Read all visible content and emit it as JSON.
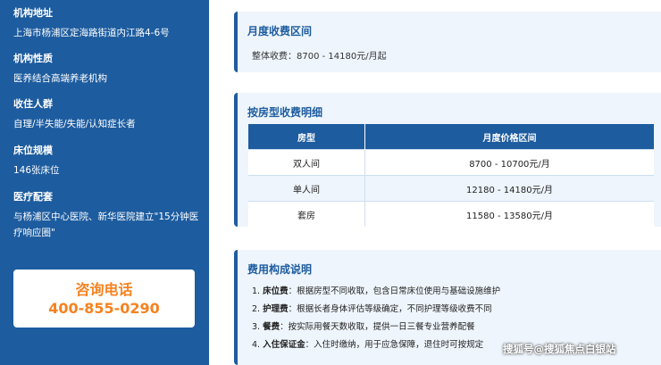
{
  "sidebar": {
    "items": [
      {
        "label": "机构地址",
        "value": "上海市杨浦区定海路街道内江路4-6号"
      },
      {
        "label": "机构性质",
        "value": "医养结合高端养老机构"
      },
      {
        "label": "收住人群",
        "value": "自理/半失能/失能/认知症长者"
      },
      {
        "label": "床位规模",
        "value": "146张床位"
      },
      {
        "label": "医疗配套",
        "value": "与杨浦区中心医院、新华医院建立\"15分钟医疗响应圈\""
      }
    ],
    "contact": {
      "label": "咨询电话",
      "phone": "400-855-0290"
    }
  },
  "monthly": {
    "title": "月度收费区间",
    "line": "整体收费：8700 - 14180元/月起"
  },
  "room_fees": {
    "title": "按房型收费明细",
    "headers": [
      "房型",
      "月度价格区间"
    ],
    "rows": [
      [
        "双人间",
        "8700 - 10700元/月"
      ],
      [
        "单人间",
        "12180 - 14180元/月"
      ],
      [
        "套房",
        "11580 - 13580元/月"
      ]
    ]
  },
  "fee_structure": {
    "title": "费用构成说明",
    "items": [
      {
        "num": "1.",
        "term": "床位费",
        "desc": "：根据房型不同收取，包含日常床位使用与基础设施维护"
      },
      {
        "num": "2.",
        "term": "护理费",
        "desc": "：根据长者身体评估等级确定，不同护理等级收费不同"
      },
      {
        "num": "3.",
        "term": "餐费",
        "desc": "：按实际用餐天数收取，提供一日三餐专业营养配餐"
      },
      {
        "num": "4.",
        "term": "入住保证金",
        "desc": "：入住时缴纳，用于应急保障，退住时可按规定"
      }
    ]
  },
  "watermark": "搜狐号@搜狐焦点白银站"
}
